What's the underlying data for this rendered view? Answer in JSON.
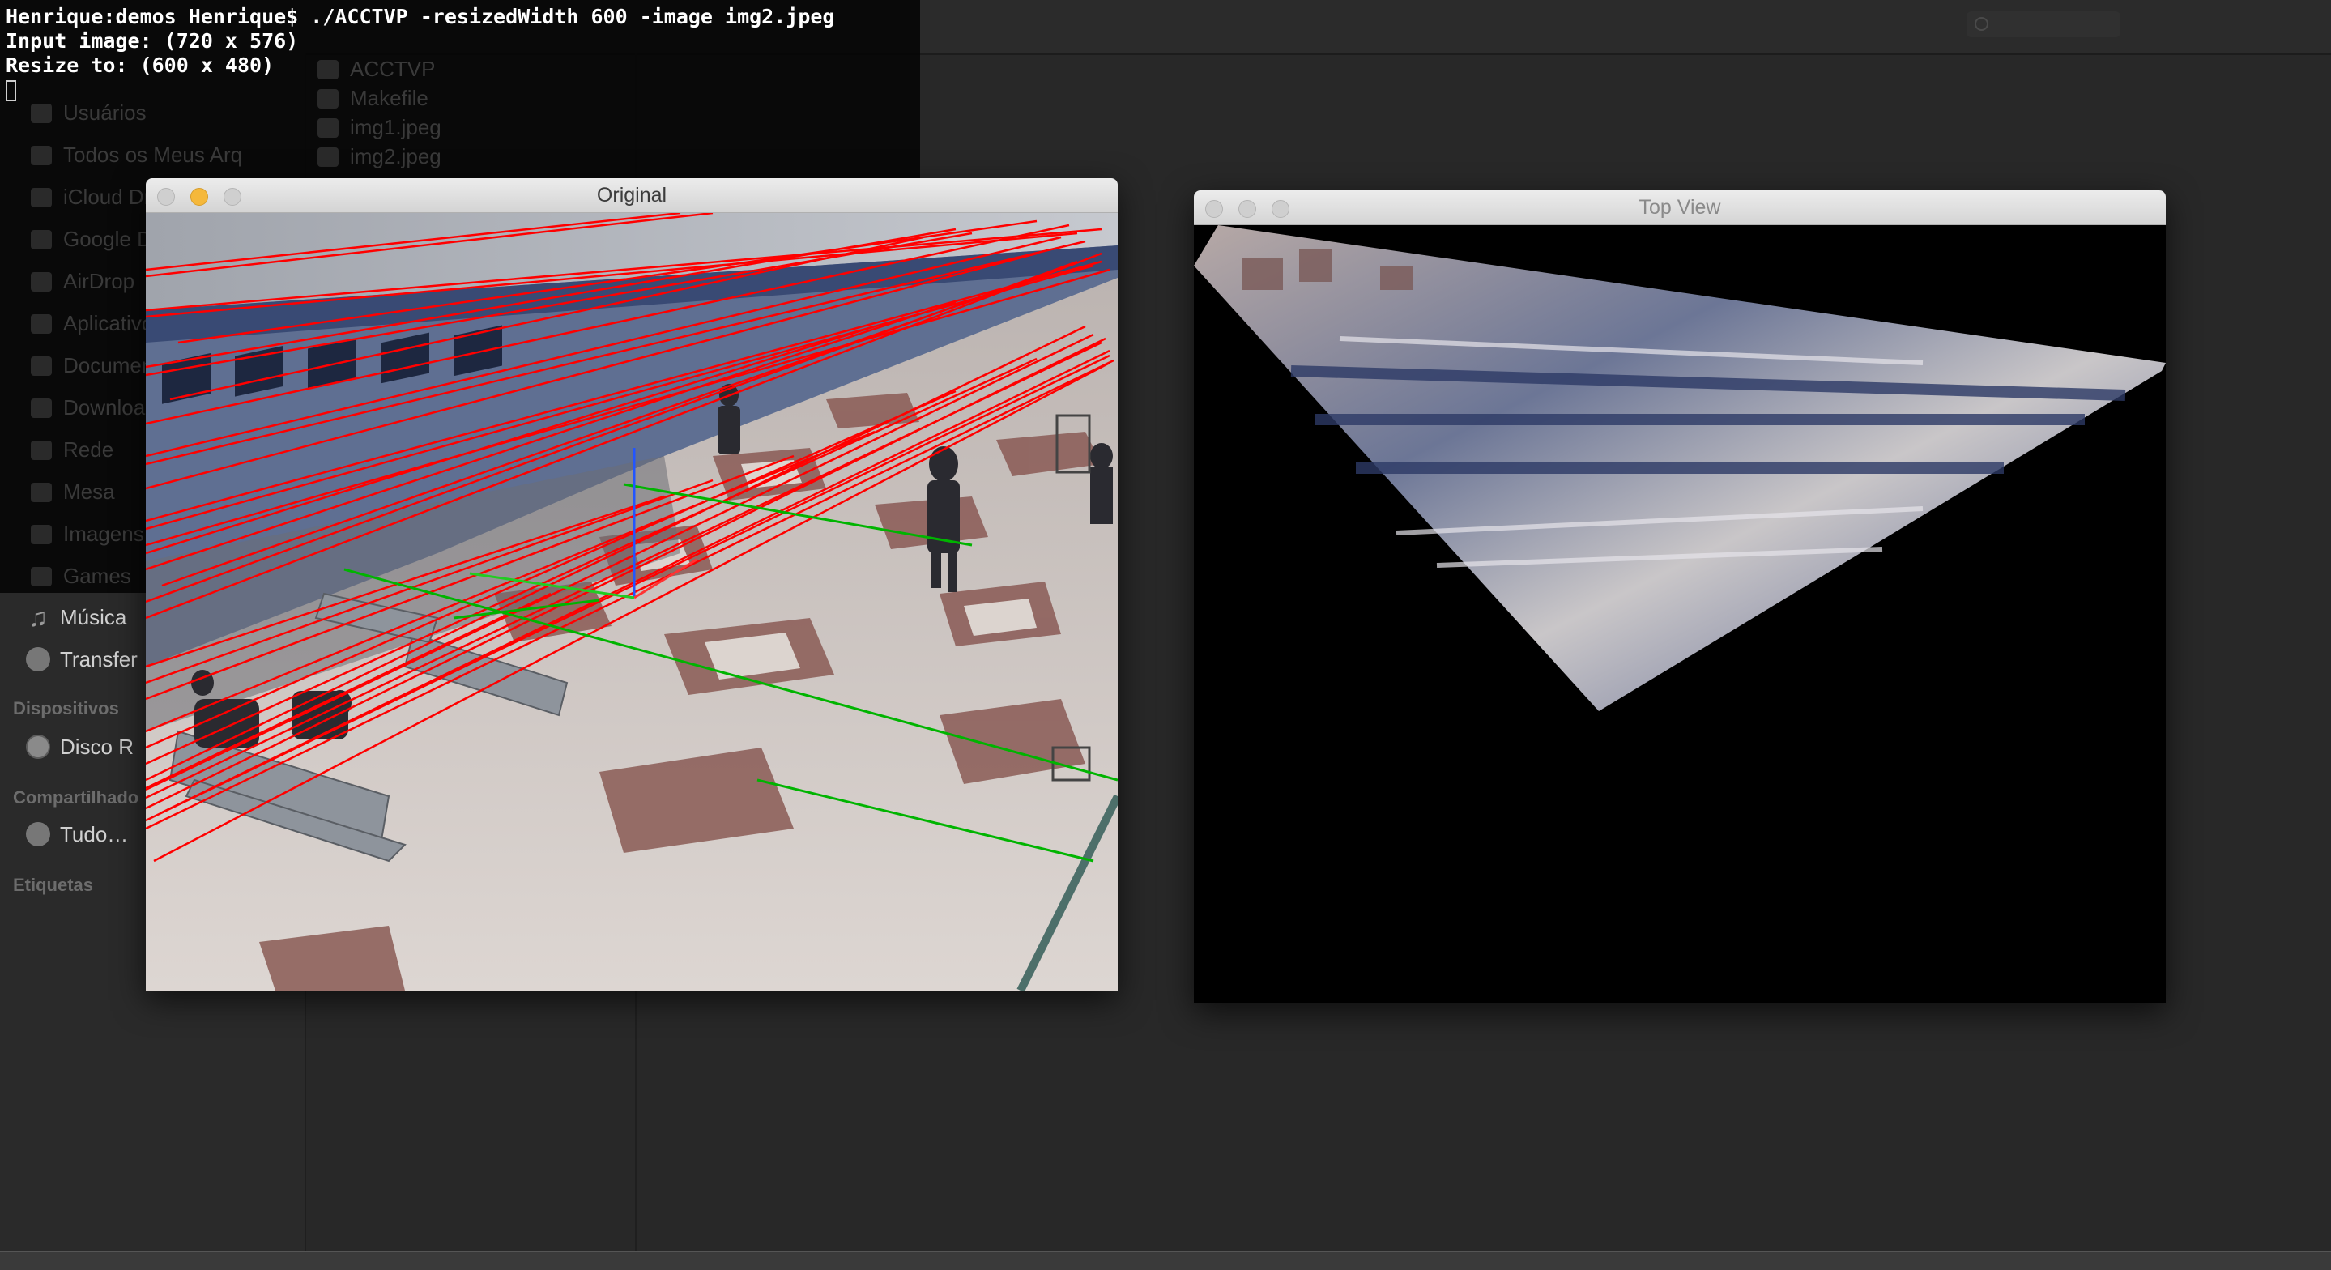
{
  "finder": {
    "sidebar": {
      "favorites_partial": [
        "Usuários",
        "Todos os Meus Arq",
        "iCloud Drive",
        "Google Drive",
        "AirDrop",
        "Aplicativos",
        "Documentos",
        "Downloads",
        "Rede",
        "Mesa",
        "Imagens",
        "Games"
      ],
      "visible_items": [
        {
          "label": "Música",
          "icon": "music-note-icon"
        },
        {
          "label": "Transfer",
          "icon": "download-icon"
        }
      ],
      "devices_header": "Dispositivos",
      "devices": [
        {
          "label": "Disco R",
          "icon": "disk-icon"
        }
      ],
      "shared_header": "Compartilhado",
      "shared": [
        {
          "label": "Tudo…",
          "icon": "network-globe-icon"
        }
      ],
      "tags_header": "Etiquetas"
    },
    "files": [
      "ACCTVP",
      "Makefile",
      "img1.jpeg",
      "img2.jpeg"
    ]
  },
  "terminal": {
    "lines": [
      "Henrique:demos Henrique$ ./ACCTVP -resizedWidth 600 -image img2.jpeg",
      "Input image: (720 x 576)",
      "Resize to: (600 x 480)"
    ]
  },
  "windows": {
    "original": {
      "title": "Original"
    },
    "top_view": {
      "title": "Top View"
    }
  },
  "colors": {
    "vanishing_lines_red": "#ff0000",
    "vanishing_lines_green": "#00c800",
    "axis_blue": "#2255ff"
  }
}
